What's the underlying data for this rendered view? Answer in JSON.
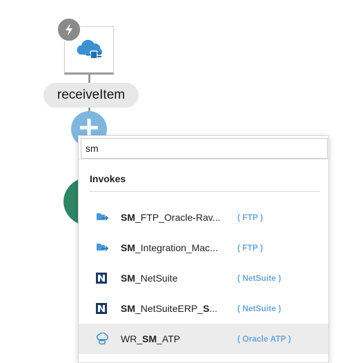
{
  "canvas": {
    "trigger_icon": "cloud-plug-icon",
    "badge_icon": "lightning-bolt-icon",
    "node_label": "receiveItem",
    "add_icon": "plus-icon"
  },
  "search": {
    "value": "sm"
  },
  "results": {
    "section_title": "Invokes",
    "items": [
      {
        "prefix": "",
        "match": "SM",
        "suffix": "_FTP_Oracle-Rav...",
        "type": "( FTP )",
        "icon": "ftp-adapter-icon"
      },
      {
        "prefix": "",
        "match": "SM",
        "suffix": "_Integration_Mac...",
        "type": "( FTP )",
        "icon": "ftp-adapter-icon"
      },
      {
        "prefix": "",
        "match": "SM",
        "suffix": "_NetSuite",
        "type": "( NetSuite )",
        "icon": "netsuite-icon"
      },
      {
        "prefix": "",
        "match": "SM",
        "suffix": "_NetSuiteERP_",
        "suffix_bold": "S",
        "suffix2": "...",
        "type": "( NetSuite )",
        "icon": "netsuite-icon"
      },
      {
        "prefix": "WR_",
        "match": "SM",
        "suffix": "_ATP",
        "type": "( Oracle ATP )",
        "icon": "oracle-atp-icon"
      }
    ]
  },
  "colors": {
    "add_button": "#7fb6e0",
    "type_label": "#6ea6d8",
    "next_node": "#2f8464",
    "highlight_row": "#ececec"
  }
}
